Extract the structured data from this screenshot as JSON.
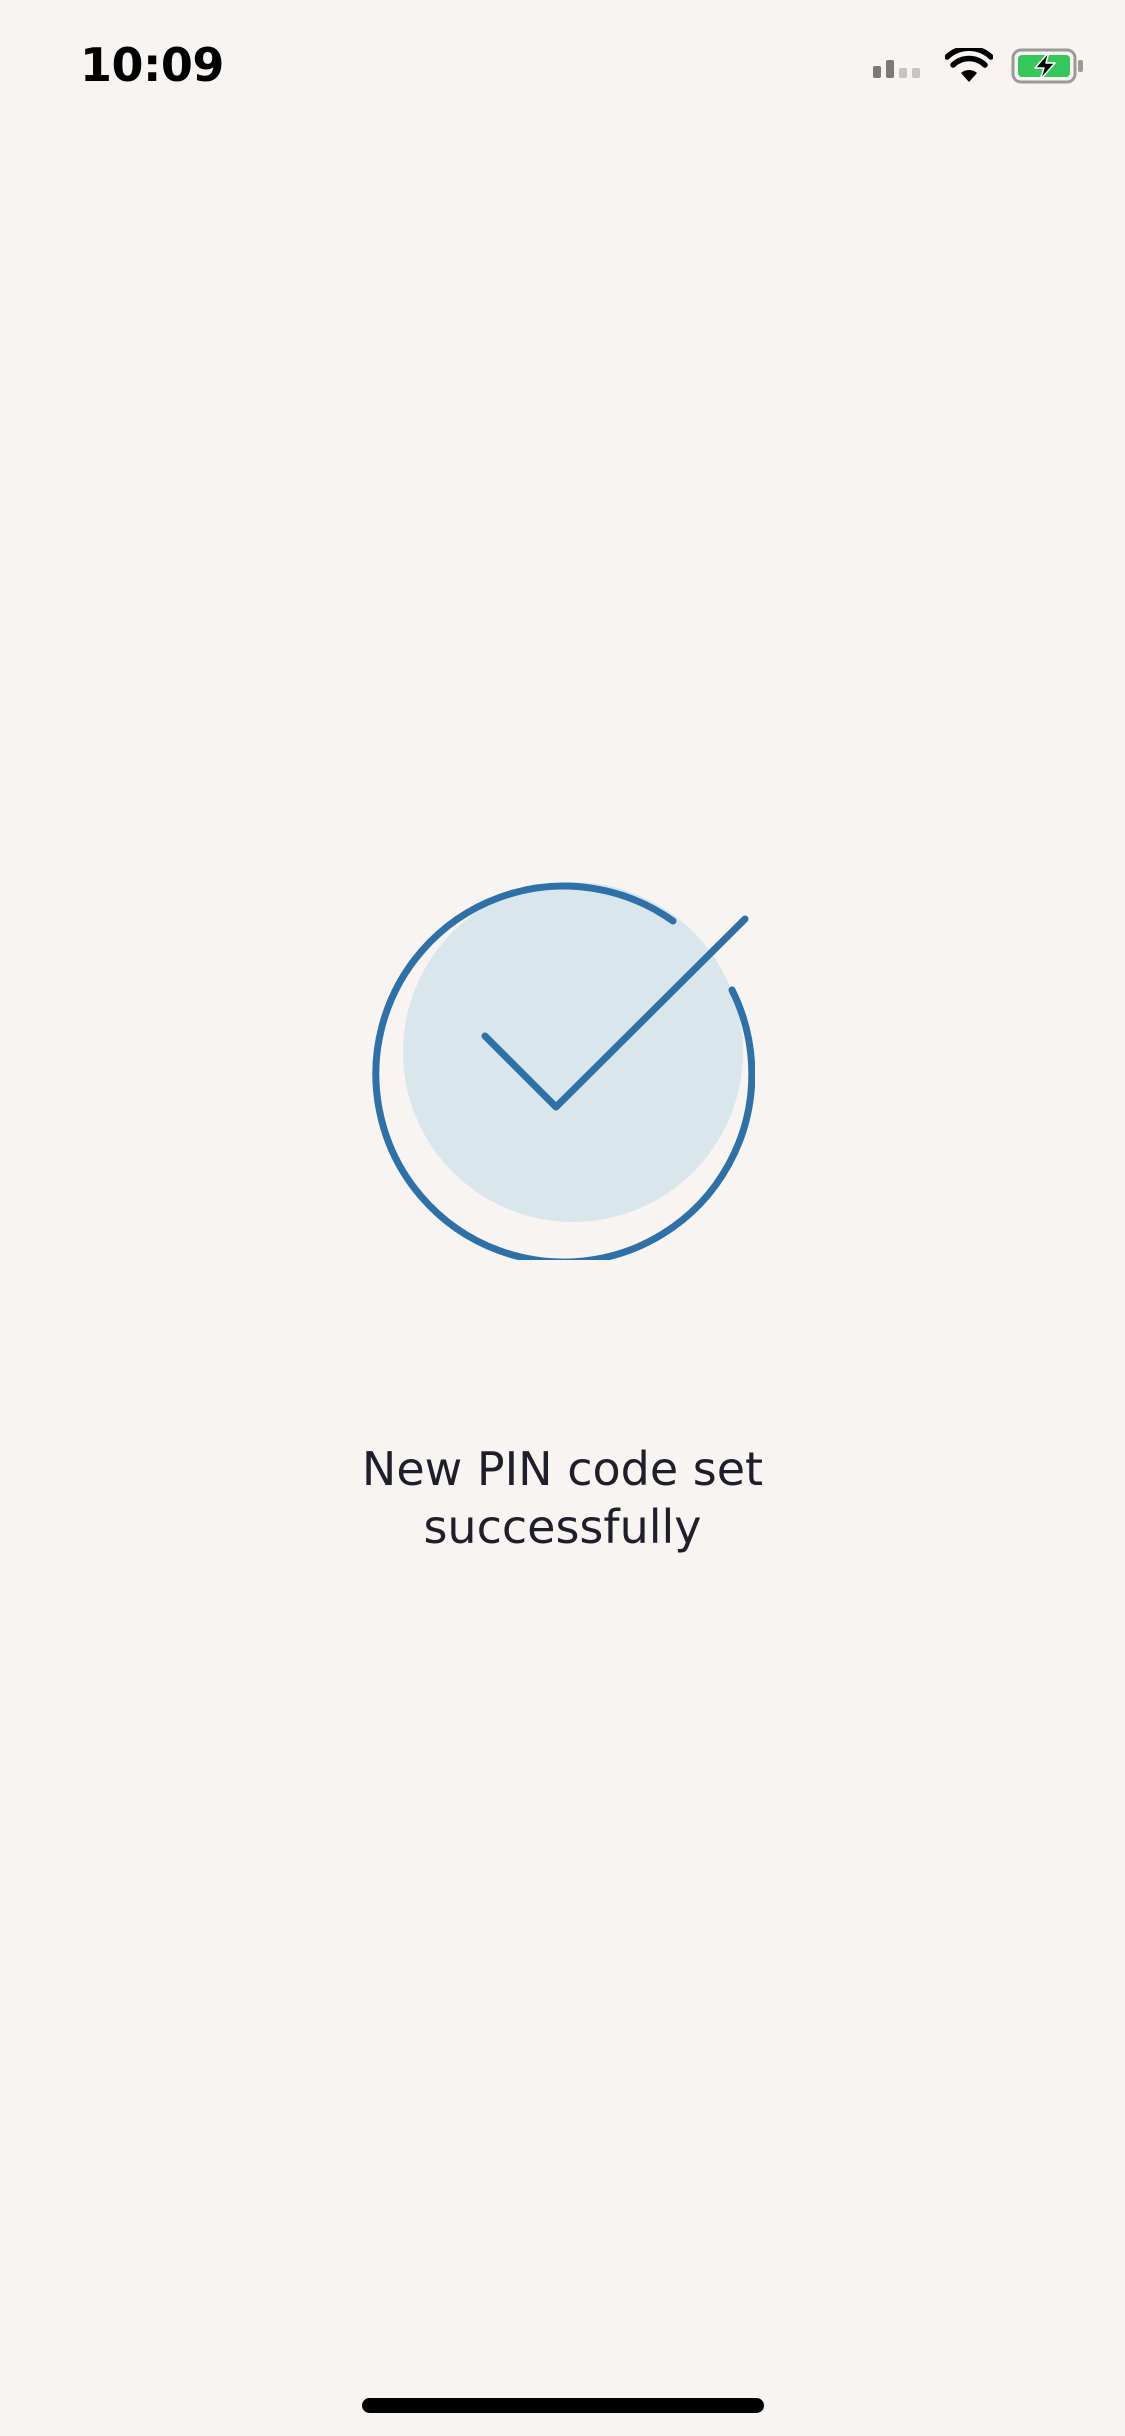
{
  "status_bar": {
    "time": "10:09",
    "icons": [
      "cellular-signal-icon",
      "wifi-icon",
      "battery-charging-icon"
    ],
    "battery_color": "#34c759"
  },
  "success": {
    "icon": "checkmark-circle-icon",
    "accent_color": "#2e70a8",
    "fill_color": "#d9e7ed",
    "message_line1": "New PIN code set",
    "message_line2": "successfully"
  }
}
